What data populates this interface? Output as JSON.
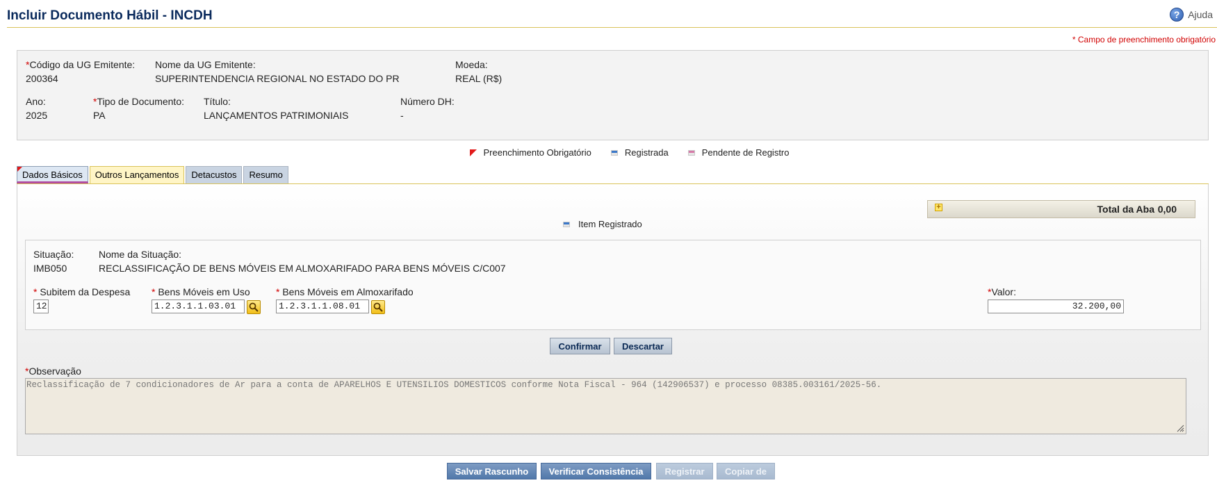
{
  "page": {
    "title": "Incluir Documento Hábil - INCDH",
    "help_label": "Ajuda",
    "required_note": "* Campo de preenchimento obrigatório"
  },
  "header": {
    "ug_code": {
      "required": "*",
      "label": "Código da UG Emitente:",
      "value": "200364"
    },
    "ug_name": {
      "label": "Nome da UG Emitente:",
      "value": "SUPERINTENDENCIA REGIONAL NO ESTADO DO PR"
    },
    "currency": {
      "label": "Moeda:",
      "value": "REAL (R$)"
    },
    "year": {
      "label": "Ano:",
      "value": "2025"
    },
    "doc_type": {
      "required": "*",
      "label": "Tipo de Documento:",
      "value": "PA"
    },
    "doc_title": {
      "label": "Título:",
      "value": "LANÇAMENTOS PATRIMONIAIS"
    },
    "dh_number": {
      "label": "Número DH:",
      "value": "-"
    }
  },
  "legend": {
    "required": "Preenchimento Obrigatório",
    "registered": "Registrada",
    "pending": "Pendente de Registro"
  },
  "tabs": [
    {
      "label": "Dados Básicos"
    },
    {
      "label": "Outros Lançamentos"
    },
    {
      "label": "Detacustos"
    },
    {
      "label": "Resumo"
    }
  ],
  "tab_total": {
    "label": "Total da Aba",
    "value": "0,00",
    "expand_icon": "plus-icon"
  },
  "item_registered": "Item Registrado",
  "item": {
    "situation": {
      "label": "Situação:",
      "value": "IMB050"
    },
    "situation_name": {
      "label": "Nome da Situação:",
      "value": "RECLASSIFICAÇÃO DE BENS MÓVEIS EM ALMOXARIFADO PARA BENS MÓVEIS C/C007"
    },
    "subitem": {
      "required": "*",
      "label": "Subitem da Despesa",
      "value": "12"
    },
    "bens_uso": {
      "required": "*",
      "label": "Bens Móveis em Uso",
      "value": "1.2.3.1.1.03.01"
    },
    "bens_almox": {
      "required": "*",
      "label": "Bens Móveis em Almoxarifado",
      "value": "1.2.3.1.1.08.01"
    },
    "valor": {
      "required": "*",
      "label": "Valor:",
      "value": "32.200,00"
    }
  },
  "item_actions": {
    "confirm": "Confirmar",
    "discard": "Descartar"
  },
  "observation": {
    "required": "*",
    "label": "Observação",
    "value": "Reclassificação de 7 condicionadores de Ar para a conta de APARELHOS E UTENSILIOS DOMESTICOS conforme Nota Fiscal - 964 (142906537) e processo 08385.003161/2025-56."
  },
  "footer_actions": {
    "save_draft": "Salvar Rascunho",
    "verify": "Verificar Consistência",
    "register": "Registrar",
    "copy": "Copiar de"
  },
  "colors": {
    "title": "#0a2a5c",
    "required": "#d10000",
    "accent_rule": "#d9c35a",
    "primary_button": "#5178aa"
  }
}
